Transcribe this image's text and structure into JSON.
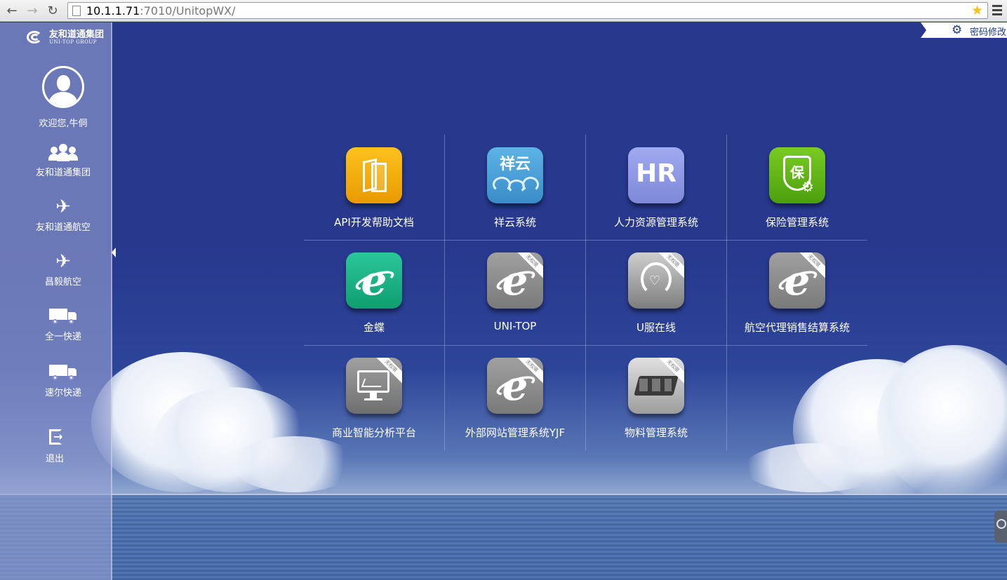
{
  "browser": {
    "url_host": "10.1.1.71",
    "url_rest": ":7010/UnitopWX/"
  },
  "logo": {
    "name_cn": "友和道通集团",
    "name_en": "UNI-TOP GROUP"
  },
  "user": {
    "welcome": "欢迎您,牛侗"
  },
  "sidebar": {
    "items": [
      {
        "label": "友和道通集团",
        "icon": "people-icon"
      },
      {
        "label": "友和道通航空",
        "icon": "airplane-icon"
      },
      {
        "label": "昌毅航空",
        "icon": "airplane-icon"
      },
      {
        "label": "全一快递",
        "icon": "truck-icon"
      },
      {
        "label": "速尔快递",
        "icon": "truck-icon"
      },
      {
        "label": "退出",
        "icon": "logout-icon"
      }
    ]
  },
  "header": {
    "password_label": "密码修改"
  },
  "apps": [
    {
      "label": "API开发帮助文档",
      "tile_text": "",
      "color": "#f2a800",
      "locked": false
    },
    {
      "label": "祥云系统",
      "tile_text": "祥云",
      "color": "#4aa0d8",
      "locked": false
    },
    {
      "label": "人力资源管理系统",
      "tile_text": "HR",
      "color": "#8a95e2",
      "locked": false
    },
    {
      "label": "保险管理系统",
      "tile_text": "保",
      "color": "#5bb515",
      "locked": false
    },
    {
      "label": "金蝶",
      "tile_text": "e",
      "color": "#15b07f",
      "locked": false
    },
    {
      "label": "UNI-TOP",
      "tile_text": "e",
      "color": "#8c8c8c",
      "locked": true
    },
    {
      "label": "U服在线",
      "tile_text": "",
      "color": "#9a9a9a",
      "locked": true
    },
    {
      "label": "航空代理销售结算系统",
      "tile_text": "e",
      "color": "#8c8c8c",
      "locked": true
    },
    {
      "label": "商业智能分析平台",
      "tile_text": "",
      "color": "#8c8c8c",
      "locked": true
    },
    {
      "label": "外部网站管理系统YJF",
      "tile_text": "e",
      "color": "#8c8c8c",
      "locked": true
    },
    {
      "label": "物料管理系统",
      "tile_text": "",
      "color": "#b9b9b9",
      "locked": true
    }
  ],
  "locked_badge": "无权限"
}
